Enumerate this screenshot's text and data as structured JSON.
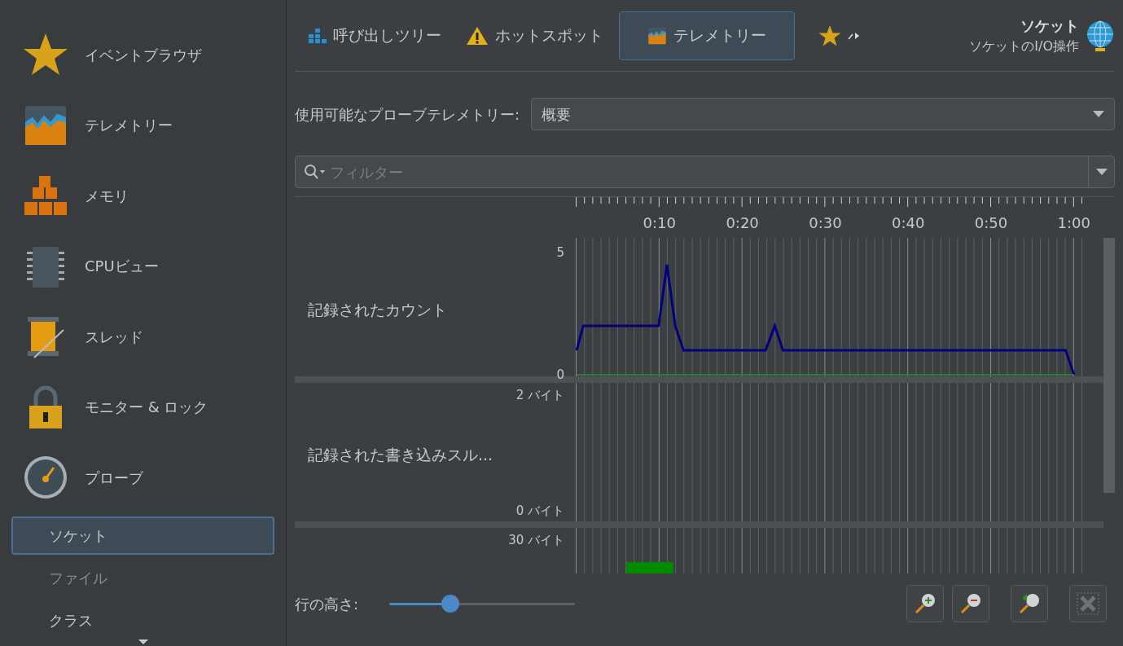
{
  "sidebar": {
    "items": [
      {
        "label": "イベントブラウザ",
        "selected": false
      },
      {
        "label": "テレメトリー",
        "selected": false
      },
      {
        "label": "メモリ",
        "selected": false
      },
      {
        "label": "CPUビュー",
        "selected": false
      },
      {
        "label": "スレッド",
        "selected": false
      },
      {
        "label": "モニター & ロック",
        "selected": false
      },
      {
        "label": "プローブ",
        "selected": false
      }
    ],
    "sub_items": [
      {
        "label": "ソケット",
        "selected": true,
        "disabled": false
      },
      {
        "label": "ファイル",
        "selected": false,
        "disabled": true
      },
      {
        "label": "クラス",
        "selected": false,
        "disabled": false
      }
    ]
  },
  "tabs": [
    {
      "label": "呼び出しツリー",
      "selected": false
    },
    {
      "label": "ホットスポット",
      "selected": false
    },
    {
      "label": "テレメトリー",
      "selected": true
    },
    {
      "selected": false
    }
  ],
  "header": {
    "title": "ソケット",
    "subtitle": "ソケットのI/O操作"
  },
  "probe_telemetry": {
    "label": "使用可能なプローブテレメトリー:",
    "value": "概要"
  },
  "filter": {
    "placeholder": "フィルター"
  },
  "rows": [
    {
      "label": "記録されたカウント",
      "chart_data": {
        "type": "line",
        "x": [
          0,
          0.8,
          9.9,
          10.9,
          11.9,
          12.9,
          22.8,
          23.9,
          24.9,
          59,
          60
        ],
        "series": [
          {
            "color": "#000080",
            "values": [
              1,
              2,
              2,
              4.5,
              2,
              1,
              1,
              2,
              1,
              1,
              0
            ]
          },
          {
            "color": "#2e7d32",
            "values": [
              0,
              0,
              0,
              0,
              0,
              0,
              0,
              0,
              0,
              0,
              0
            ]
          }
        ],
        "xlim": [
          0,
          60
        ],
        "ylim": [
          0,
          5.6
        ],
        "grid": true,
        "xticks": [
          {
            "value": 10,
            "label": "0:10"
          },
          {
            "value": 20,
            "label": "0:20"
          },
          {
            "value": 30,
            "label": "0:30"
          },
          {
            "value": 40,
            "label": "0:40"
          },
          {
            "value": 50,
            "label": "0:50"
          },
          {
            "value": 60,
            "label": "1:00"
          }
        ],
        "yticks": [
          0,
          5
        ]
      }
    },
    {
      "label": "記録された書き込みスル...",
      "y_top": "2 バイト",
      "y_bottom": "0 バイト"
    },
    {
      "y_top": "30 バイト"
    }
  ],
  "row_height": {
    "label": "行の高さ:",
    "level": 0.33
  }
}
